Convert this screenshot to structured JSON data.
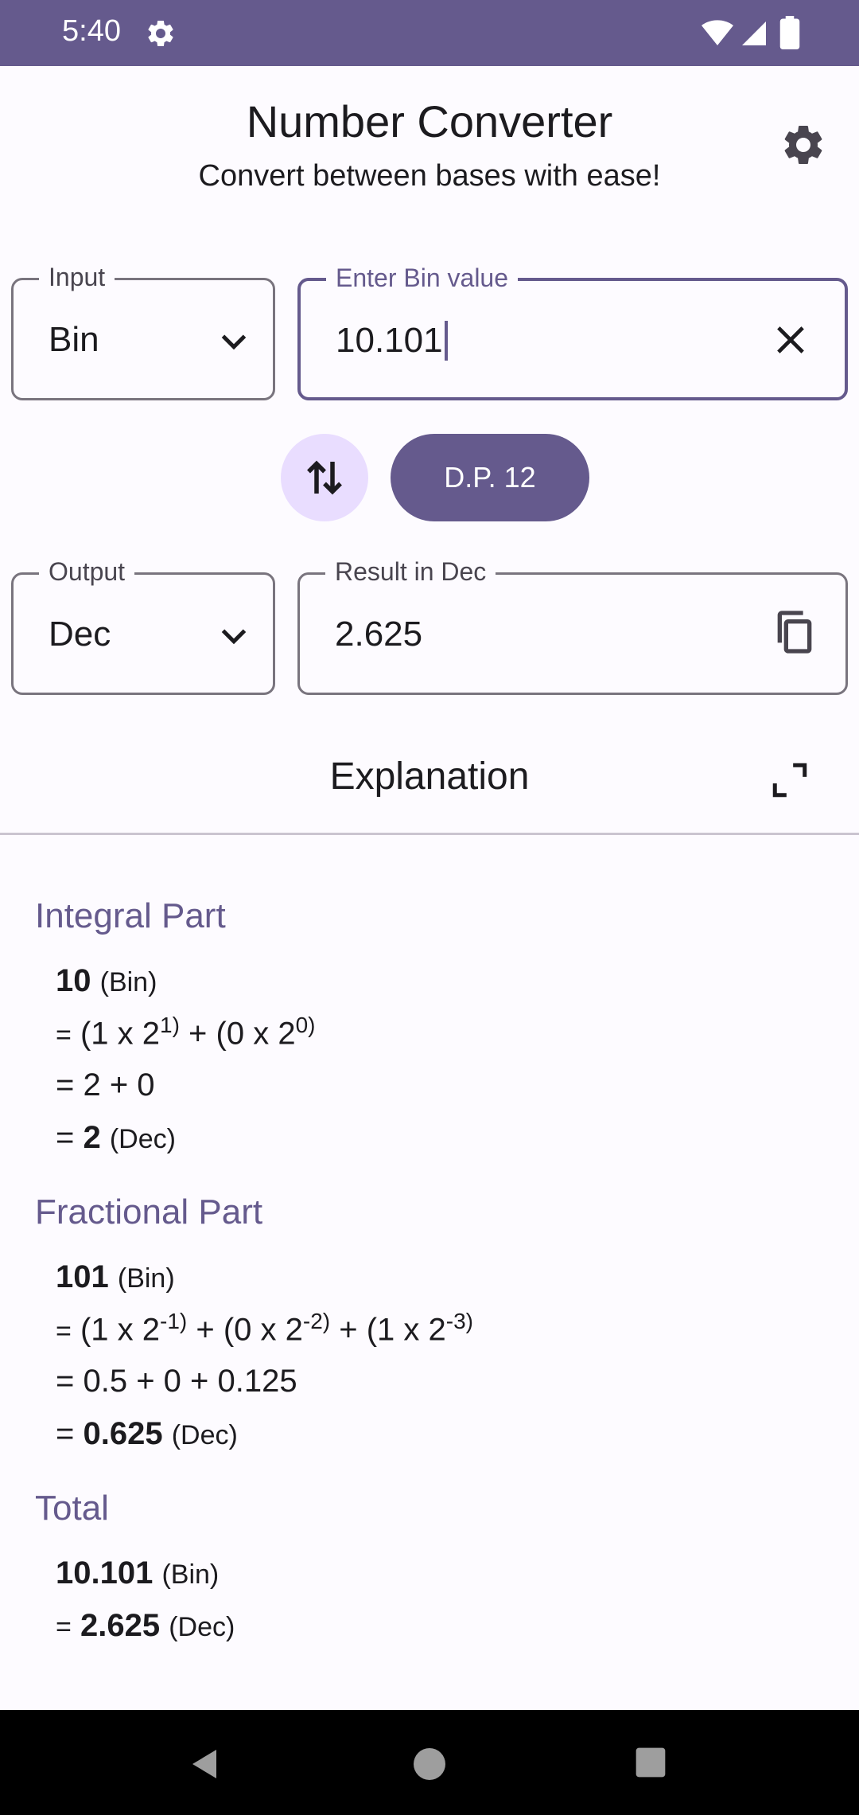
{
  "status_bar": {
    "time": "5:40"
  },
  "header": {
    "title": "Number Converter",
    "subtitle": "Convert between bases with ease!"
  },
  "input": {
    "base_label": "Input",
    "base_value": "Bin",
    "value_label": "Enter Bin value",
    "value": "10.101"
  },
  "controls": {
    "dp_label": "D.P. 12"
  },
  "output": {
    "base_label": "Output",
    "base_value": "Dec",
    "result_label": "Result in Dec",
    "result": "2.625"
  },
  "explanation": {
    "title": "Explanation",
    "integral": {
      "title": "Integral Part",
      "l1_num": "10",
      "l1_unit": "(Bin)",
      "l2_eq": "=",
      "l2_a": "(1 x 2",
      "l2_a_exp": "1)",
      "l2_b": " + (0 x 2",
      "l2_b_exp": "0)",
      "l3": "= 2 + 0",
      "l4_eq": "=",
      "l4_num": "2",
      "l4_unit": "(Dec)"
    },
    "fractional": {
      "title": "Fractional Part",
      "l1_num": "101",
      "l1_unit": "(Bin)",
      "l2_eq": "=",
      "l2_a": "(1 x 2",
      "l2_a_exp": "-1)",
      "l2_b": " + (0 x 2",
      "l2_b_exp": "-2)",
      "l2_c": " + (1 x 2",
      "l2_c_exp": "-3)",
      "l3": "= 0.5 + 0 + 0.125",
      "l4_eq": "=",
      "l4_num": "0.625",
      "l4_unit": "(Dec)"
    },
    "total": {
      "title": "Total",
      "l1_num": "10.101",
      "l1_unit": "(Bin)",
      "l2_eq": "=",
      "l2_num": "2.625",
      "l2_unit": "(Dec)"
    }
  },
  "colors": {
    "primary": "#655A8D",
    "primary_container": "#E9DDFF",
    "background": "#FDFBFF"
  },
  "icons": [
    "settings-icon",
    "chevron-down-icon",
    "close-icon",
    "swap-icon",
    "copy-icon",
    "expand-icon",
    "back-icon",
    "home-icon",
    "recents-icon"
  ]
}
